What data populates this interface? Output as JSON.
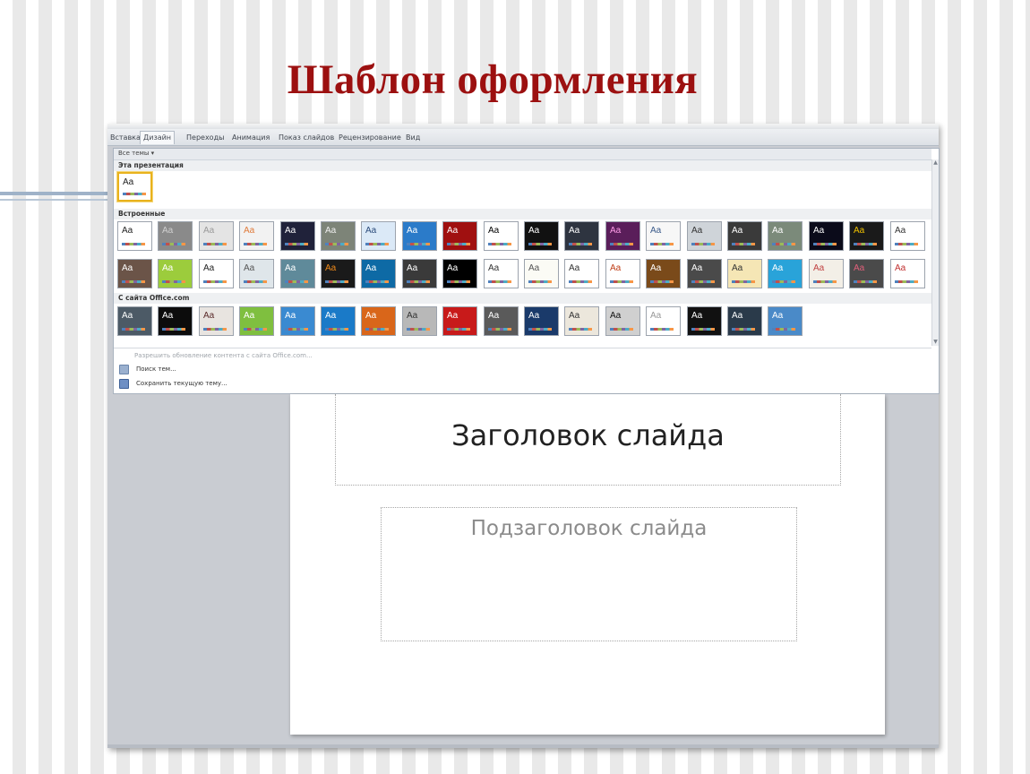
{
  "heading": "Шаблон оформления",
  "ribbon": {
    "tabs": [
      "Вставка",
      "Дизайн",
      "Переходы",
      "Анимация",
      "Показ слайдов",
      "Рецензирование",
      "Вид"
    ],
    "active_tab": "Дизайн"
  },
  "gallery": {
    "filter_label": "Все темы ▾",
    "sections": {
      "this_presentation": "Эта презентация",
      "builtin": "Встроенные",
      "office_com": "С сайта Office.com"
    },
    "theme_glyph": "Aa",
    "builtin_row1": [
      {
        "bg": "#ffffff",
        "fg": "#222"
      },
      {
        "bg": "#8a8a8a",
        "fg": "#d0d0d0"
      },
      {
        "bg": "#e4e4e4",
        "fg": "#9a9a9a"
      },
      {
        "bg": "#f2f2f2",
        "fg": "#e07a3a"
      },
      {
        "bg": "#20223a",
        "fg": "#ffffff"
      },
      {
        "bg": "#7d8478",
        "fg": "#f0f0f0"
      },
      {
        "bg": "#dbe9f7",
        "fg": "#2a4a7a"
      },
      {
        "bg": "#2b7bc9",
        "fg": "#ffffff"
      },
      {
        "bg": "#a01010",
        "fg": "#ffffff"
      },
      {
        "bg": "#ffffff",
        "fg": "#000000"
      },
      {
        "bg": "#111111",
        "fg": "#ffffff"
      },
      {
        "bg": "#2e3440",
        "fg": "#ffffff"
      },
      {
        "bg": "#5a1e5a",
        "fg": "#ff9de8"
      },
      {
        "bg": "#f7f7f7",
        "fg": "#3a5a8a"
      },
      {
        "bg": "#cfd4d9",
        "fg": "#333"
      },
      {
        "bg": "#3a3a3a",
        "fg": "#ffffff"
      },
      {
        "bg": "#7b8a7a",
        "fg": "#ffffff"
      },
      {
        "bg": "#0b0b1a",
        "fg": "#ffffff"
      },
      {
        "bg": "#1a1a1a",
        "fg": "#f2c200"
      },
      {
        "bg": "#ffffff",
        "fg": "#333"
      }
    ],
    "builtin_row2": [
      {
        "bg": "#6b5448",
        "fg": "#ffffff"
      },
      {
        "bg": "#9ccc3c",
        "fg": "#ffffff"
      },
      {
        "bg": "#ffffff",
        "fg": "#222"
      },
      {
        "bg": "#dfe6ea",
        "fg": "#555"
      },
      {
        "bg": "#5f8a9a",
        "fg": "#ffffff"
      },
      {
        "bg": "#1a1a1a",
        "fg": "#f08a1a"
      },
      {
        "bg": "#0e6aa5",
        "fg": "#ffffff"
      },
      {
        "bg": "#3a3a3a",
        "fg": "#ffffff"
      },
      {
        "bg": "#000000",
        "fg": "#ffffff"
      },
      {
        "bg": "#ffffff",
        "fg": "#333"
      },
      {
        "bg": "#fbfbf5",
        "fg": "#555"
      },
      {
        "bg": "#ffffff",
        "fg": "#333"
      },
      {
        "bg": "#ffffff",
        "fg": "#c0401a"
      },
      {
        "bg": "#7a4a1a",
        "fg": "#ffffff"
      },
      {
        "bg": "#4a4a4a",
        "fg": "#ffffff"
      },
      {
        "bg": "#f5e6b5",
        "fg": "#333"
      },
      {
        "bg": "#29a3d9",
        "fg": "#ffffff"
      },
      {
        "bg": "#f3efe7",
        "fg": "#c04040"
      },
      {
        "bg": "#4a4a4a",
        "fg": "#e0607a"
      },
      {
        "bg": "#ffffff",
        "fg": "#c03030"
      }
    ],
    "office_row": [
      {
        "bg": "#4c5a66",
        "fg": "#ffffff"
      },
      {
        "bg": "#0c0c0c",
        "fg": "#ffffff"
      },
      {
        "bg": "#e8e4e0",
        "fg": "#5a2a2a"
      },
      {
        "bg": "#7fbf3f",
        "fg": "#ffffff"
      },
      {
        "bg": "#3a8ad1",
        "fg": "#ffffff"
      },
      {
        "bg": "#1a7ac8",
        "fg": "#ffffff"
      },
      {
        "bg": "#d9661a",
        "fg": "#ffffff"
      },
      {
        "bg": "#b8b8b8",
        "fg": "#333"
      },
      {
        "bg": "#c81a1a",
        "fg": "#ffffff"
      },
      {
        "bg": "#5a5a5a",
        "fg": "#ffffff"
      },
      {
        "bg": "#1a3a6a",
        "fg": "#ffffff"
      },
      {
        "bg": "#ece7dc",
        "fg": "#333"
      },
      {
        "bg": "#d0d0d0",
        "fg": "#111"
      },
      {
        "bg": "#ffffff",
        "fg": "#999"
      },
      {
        "bg": "#111111",
        "fg": "#ffffff"
      },
      {
        "bg": "#2a3a4a",
        "fg": "#ffffff"
      },
      {
        "bg": "#4a8ac8",
        "fg": "#ffffff"
      }
    ],
    "menu": {
      "update": "Разрешить обновление контента с сайта Office.com...",
      "search": "Поиск тем...",
      "save": "Сохранить текущую тему..."
    }
  },
  "slide": {
    "title_placeholder": "Заголовок слайда",
    "subtitle_placeholder": "Подзаголовок слайда"
  }
}
